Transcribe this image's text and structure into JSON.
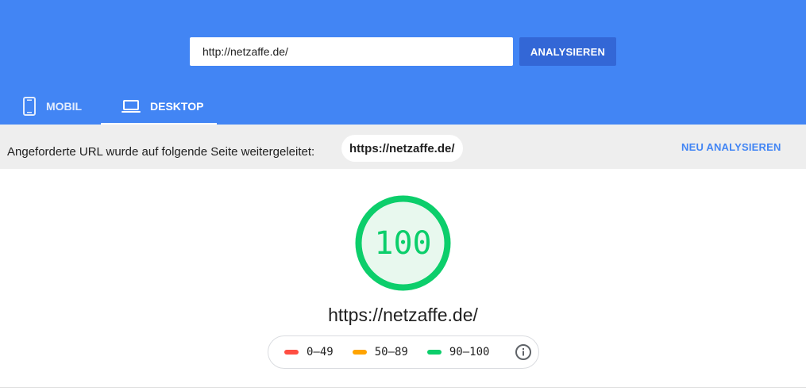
{
  "search": {
    "url_value": "http://netzaffe.de/",
    "analyze_label": "ANALYSIEREN"
  },
  "tabs": [
    {
      "label": "MOBIL",
      "icon": "smartphone-icon",
      "active": false
    },
    {
      "label": "DESKTOP",
      "icon": "laptop-icon",
      "active": true
    }
  ],
  "redirect": {
    "message": "Angeforderte URL wurde auf folgende Seite weitergeleitet:",
    "final_url": "https://netzaffe.de/",
    "reanalyze_label": "NEU ANALYSIEREN"
  },
  "report": {
    "score": "100",
    "score_value": 100,
    "url": "https://netzaffe.de/"
  },
  "legend": [
    {
      "range": "0–49",
      "color": "#ff4e42"
    },
    {
      "range": "50–89",
      "color": "#ffa400"
    },
    {
      "range": "90–100",
      "color": "#0cce6b"
    }
  ],
  "colors": {
    "header_bg": "#4285f4",
    "button_bg": "#3367d6",
    "pass": "#0cce6b",
    "pass_fill": "#e8f8ee"
  }
}
